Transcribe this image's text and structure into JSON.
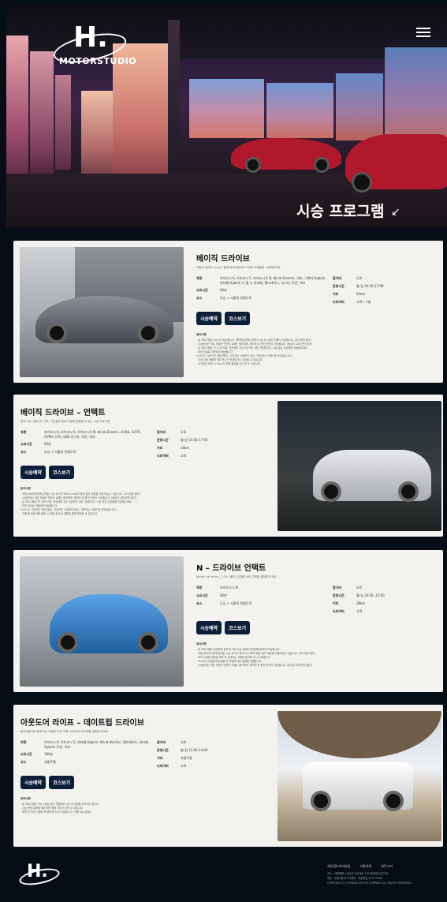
{
  "brand": {
    "logo_letter": "H.",
    "logo_word": "MOTORSTUDIO"
  },
  "hero": {
    "title": "시승 프로그램",
    "arrow": "↙"
  },
  "labels": {
    "car": "차량",
    "duration": "소요시간",
    "course": "코스",
    "fee": "참가비",
    "hours": "운영시간",
    "distance": "거리",
    "driver": "드라이버"
  },
  "buttons": {
    "reserve": "시승예약",
    "course": "코스보기"
  },
  "programs": [
    {
      "title": "베이직 드라이브",
      "subtitle": "차종의 전반적 Guru가 함께 현대자동차의 다양한 차량들을 시승해보세요.",
      "car": "아이오닉 6, 아이오닉 5, 아이오닉 6 N, 캐스퍼 Electric, 넥쏘, 그랜저 Hybrid, 싼타페 Hybrid, 디 올 뉴 싼타페, 팰리세이드, 쏘나타, 투싼, 넥쏘",
      "duration": "60분",
      "course": "도심 + 서울의 한밤도로",
      "fee": "무료",
      "hours": "월-일 10:30-17:00",
      "distance": "24km",
      "driver": "고객 / 그룹",
      "notice_title": "유의사항",
      "notices": [
        "- 본 프로그램은 Guru가 동승합니다. 예약하시면에 입력된 시승 코스로만 주행이 가능합니다. (코스변경 불가)",
        "- 시승준비는 적은 차례는 빈만의 교체는 불가하며, 예약자 본 운전 준전이 가능합니다. (동승자 교체 운전 불가)",
        "- 본 프로그램은 만 21세 이상, 운전경력 1년 이상이며 사용 가능합니다. 시승 당일 신분증을 지참해주세요.",
        "- 여러 연료로 이동되어 배송됩니다.",
        "(도서 단, 가려지인 작업이었다, 가려지인 스태프의 대신, 가려지는 스태프 옵 보되었습니다.)",
        "- 기상 상황 방출에 따라 포시가 변경되거나 취소될 수 있습니다.",
        "- 고객님은 요청 시 Guru가 차량 점검을 대신 할 수 있습니다."
      ]
    },
    {
      "title": "베이직 드라이브 – 언택트",
      "subtitle": "한적 또는 사람이는 가족, 가인들과 함께 차량에 집중할 수 있는 시승 프로그램",
      "car": "아이오닉 6, 아이오닉 5, 아이오닉 6 N, 캐스퍼 Electric, GV60, GV70, GV80, G70, G80 전기차, 투싼, 넥쏘",
      "duration": "60분",
      "course": "도심 + 서울의 한밤도로",
      "fee": "무료",
      "hours": "월-일 10:30-17:00",
      "distance": "18km",
      "driver": "고객",
      "notice_title": "유의사항",
      "notices": [
        "- 차량 내비게이션에 입력된 시승 코스를 따라 Guru와의 동반 없이 차량을 주행 하실 수 있습니다. (코스변경 불가)",
        "- 시승준비는 적은 차례는 빈만의 교체는 불가하며, 예약자 본 운전 준전이 가능합니다. (동승자 교체 운전 불가)",
        "- 본 프로그램은 만 26세 이상, 운전경력 3년 이상이며 사용 가능합니다. 시승 당일 신분증을 지참해주세요.",
        "- 여러 연료로 이동되어 배송됩니다.",
        "(도서 단, 가려지인 작업이었다, 가려지인 스태프의 대신, 가려지는 스태프 옵 보되었습니다.)",
        "- 주행 중 응급사항 발생 시 차량 내 SOS 버튼을 통해 연락할 수 있습니다."
      ]
    },
    {
      "title": "N – 드라이브 언택트",
      "subtitle": "Never just drive. 그 어느 때보다 강렬한 N의 주행을 경험해 보세요.",
      "car": "아이오닉 5 N",
      "duration": "90분",
      "course": "도심 + 서울의 한밤도로",
      "fee": "무료",
      "hours": "월-일 10:30, 15:00",
      "distance": "38km",
      "driver": "고객",
      "notice_title": "유의사항",
      "notices": [
        "- 본 프로그램은 운전면허 취득 후 3년 이상 경과한 운전자에 한하여 가능합니다.",
        "- 차량 내비게이션에 입력된 시승 코스를 따라 Guru와의 동반 없이 차량을 주행하실 수 있습니다. (코스변경 불가)",
        "- 보다 자세한 내용은 예약 후 안내되는 사항을 참고해 주시기 바랍니다.",
        "- Guru는 안전을 위해 출발 전 차량에 대한 설명을 진행합니다.",
        "- 시승준비는 적은 차례는 빈만의 교체는 불가하며, 예약자 본 운전 준전이 가능합니다. (동승자 교체 운전 불가)"
      ]
    },
    {
      "title": "아웃도어 라이프 – 데이트립 드라이브",
      "subtitle": "현대자동차와 함께 하는 특별한 하루 여행. 아웃도어 라이프를 경험해 보세요.",
      "car": "아이오닉 6, 아이오닉 5, 싼타페 Hybrid, 캐스퍼 Electric, 팰리세이드, 싼타페 Hybrid, 투싼, 넥쏘",
      "duration": "180분",
      "course": "자율주행",
      "fee": "유료",
      "hours": "월-일 11:00-14:00",
      "distance": "자율주행",
      "driver": "고객",
      "notice_title": "유의사항",
      "notices": [
        "- 본 프로그램은 Guru 동승 없이 진행되며 시승 전 점검을 받으셔야 합니다.",
        "- 시승 준비 일정에 따라 예약 확정 여부가 다를 수 있습니다.",
        "- 예약 전 안내 사항을 꼭 확인해 주시기 바랍니다. (이용 요금 발생)"
      ]
    }
  ],
  "footer": {
    "logo_letter": "H.",
    "links": [
      "개인정보처리방침",
      "이용약관",
      "법적고지"
    ],
    "lines": [
      "주소 : 서울특별시 강남구 도산대로 718 현대모터스튜디오",
      "대표 : 현대자동차 고객센터 · 대표번호 1577-0006",
      "COPYRIGHT(C) HYUNDAI MOTOR COMPANY. ALL RIGHTS RESERVED."
    ]
  }
}
